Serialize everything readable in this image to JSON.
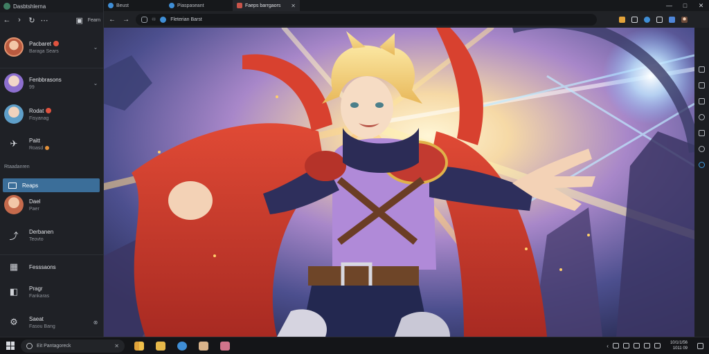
{
  "sidebar": {
    "app_title": "Dasbtshlerna",
    "nav": {
      "back": "←",
      "forward": "›",
      "refresh": "↻",
      "menu": "⋯"
    },
    "action_label": "Fearn",
    "chats": [
      {
        "name": "Pacbaret",
        "sub": "Baraga Sears",
        "avatar_color": "#e2936f",
        "has_badge": true
      },
      {
        "name": "Fenbbrasons",
        "sub": "99",
        "avatar_color": "#9b7fd6",
        "has_badge": false
      },
      {
        "name": "Rodat",
        "sub": "Fisyanag",
        "avatar_color": "#5f9fc9",
        "has_badge": true
      },
      {
        "name": "Paitt",
        "sub": "Roasd",
        "icon": "pin-icon",
        "has_badge": false
      },
      {
        "name": "Reaps",
        "icon": "card-icon",
        "active": true
      },
      {
        "name": "Dael",
        "sub": "Paer",
        "avatar_color": "#d37a5c"
      },
      {
        "name": "Derbanen",
        "sub": "Teovto",
        "icon": "share-icon"
      },
      {
        "name": "Fesssaons",
        "icon": "calendar-icon"
      },
      {
        "name": "Pragr",
        "sub": "Fankaras",
        "icon": "file-icon"
      },
      {
        "name": "Saeat",
        "sub": "Fasou Bang",
        "icon": "gear-icon"
      }
    ],
    "section_label": "Rtaadanren"
  },
  "browser": {
    "tabs": [
      {
        "label": "Beust",
        "fav_color": "#3f8ed6"
      },
      {
        "label": "Piaspaseant",
        "fav_color": "#3f8ed6"
      },
      {
        "label": "Faeps barrgaors",
        "fav_color": "#c9544a",
        "active": true
      }
    ],
    "window_controls": [
      "—",
      "□",
      "✕"
    ],
    "url_text": "Fleterian Barst",
    "extension_colors": [
      "#e3a33a",
      "#d6d9de",
      "#3f8ed6",
      "#d6d9de",
      "#4f86d9"
    ]
  },
  "taskbar": {
    "search_text": "Eit Pantagoreck",
    "pins": [
      "#e0a23a",
      "#e6b84a",
      "#3f8ed6",
      "#d9b38a",
      "#d1748b"
    ],
    "clock_time": "10/1/1/56",
    "clock_date": "1011 09"
  },
  "colors": {
    "accent": "#3b6e99",
    "badge": "#e0533f"
  }
}
